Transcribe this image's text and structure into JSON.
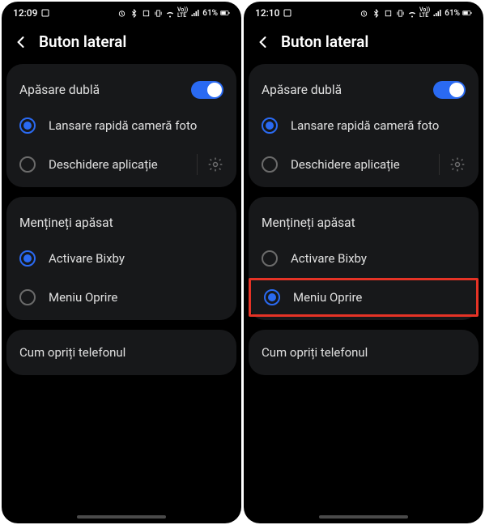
{
  "left": {
    "status": {
      "time": "12:09",
      "battery": "61%",
      "signal_text": "Vo)) LTE"
    },
    "title": "Buton lateral",
    "section1": {
      "head": "Apăsare dublă",
      "opt1": "Lansare rapidă cameră foto",
      "opt2": "Deschidere aplicație",
      "selected": 0
    },
    "section2": {
      "head": "Mențineți apăsat",
      "opt1": "Activare Bixby",
      "opt2": "Meniu Oprire",
      "selected": 0
    },
    "section3": {
      "label": "Cum opriți telefonul"
    }
  },
  "right": {
    "status": {
      "time": "12:10",
      "battery": "61%",
      "signal_text": "Vo)) LTE"
    },
    "title": "Buton lateral",
    "section1": {
      "head": "Apăsare dublă",
      "opt1": "Lansare rapidă cameră foto",
      "opt2": "Deschidere aplicație",
      "selected": 0
    },
    "section2": {
      "head": "Mențineți apăsat",
      "opt1": "Activare Bixby",
      "opt2": "Meniu Oprire",
      "selected": 1
    },
    "section3": {
      "label": "Cum opriți telefonul"
    }
  }
}
